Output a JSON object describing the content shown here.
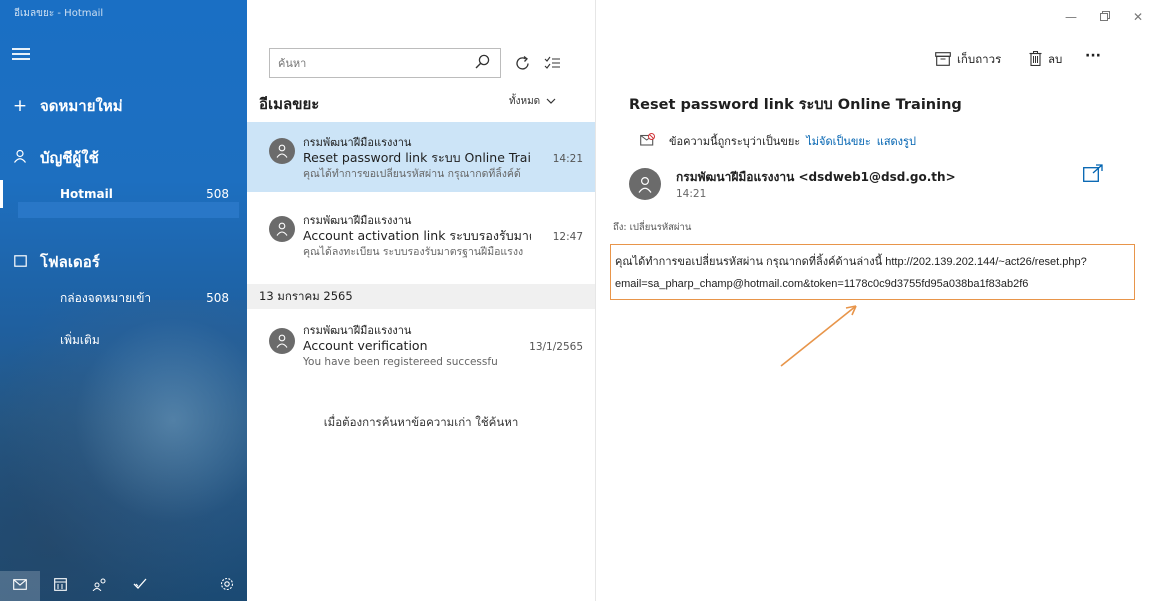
{
  "window": {
    "title": "อีเมลขยะ - Hotmail"
  },
  "nav": {
    "new_mail": "จดหมายใหม่",
    "accounts": "บัญชีผู้ใช้",
    "account_items": [
      {
        "label": "Hotmail",
        "count": "508"
      }
    ],
    "folders": "โฟลเดอร์",
    "folder_items": [
      {
        "label": "กล่องจดหมายเข้า",
        "count": "508"
      },
      {
        "label": "เพิ่มเติม",
        "count": ""
      }
    ]
  },
  "list": {
    "search_placeholder": "ค้นหา",
    "folder_title": "อีเมลขยะ",
    "filter_label": "ทั้งหมด",
    "messages": [
      {
        "sender": "กรมพัฒนาฝีมือแรงงาน",
        "subject": "Reset password link ระบบ Online Training",
        "time": "14:21",
        "preview": "คุณได้ทำการขอเปลี่ยนรหัสผ่าน กรุณากดที่ลิ้งค์ด้"
      },
      {
        "sender": "กรมพัฒนาฝีมือแรงงาน",
        "subject": "Account activation link ระบบรองรับมาตรฐา",
        "time": "12:47",
        "preview": "คุณได้ลงทะเบียน ระบบรองรับมาตรฐานฝีมือแรงง"
      },
      {
        "sender": "กรมพัฒนาฝีมือแรงงาน",
        "subject": "Account verification",
        "time": "13/1/2565",
        "preview": "You have been registereed successfu"
      }
    ],
    "date_group": "13 มกราคม 2565",
    "search_older": "เมื่อต้องการค้นหาข้อความเก่า ใช้ค้นหา"
  },
  "reader": {
    "archive_label": "เก็บถาวร",
    "delete_label": "ลบ",
    "more_label": "···",
    "subject": "Reset password link ระบบ Online Training",
    "junk_notice": "ข้อความนี้ถูกระบุว่าเป็นขยะ",
    "not_junk_link": "ไม่จัดเป็นขยะ",
    "show_images_link": "แสดงรูป",
    "from": "กรมพัฒนาฝีมือแรงงาน <dsdweb1@dsd.go.th>",
    "time": "14:21",
    "to": "ถึง: เปลี่ยนรหัสผ่าน",
    "body_line1": "คุณได้ทำการขอเปลี่ยนรหัสผ่าน กรุณากดที่ลิ้งค์ด้านล่างนี้ http://202.139.202.144/~act26/reset.php?",
    "body_line2": "email=sa_pharp_champ@hotmail.com&token=1178c0c9d3755fd95a038ba1f83ab2f6"
  },
  "colors": {
    "nav_blue": "#1a6fc4",
    "selected_row": "#cce4f7",
    "link": "#0063b1",
    "annotation": "#e8954a"
  },
  "icons": {
    "nav": [
      "hamburger-icon",
      "plus-icon",
      "person-icon",
      "folder-icon"
    ],
    "bottom": [
      "mail-icon",
      "calendar-icon",
      "people-icon",
      "todo-icon",
      "settings-icon"
    ],
    "list_tools": [
      "search-icon",
      "sync-icon",
      "select-mode-icon",
      "chevron-down-icon"
    ],
    "reader": [
      "archive-icon",
      "trash-icon",
      "more-icon",
      "junk-shield-icon",
      "popout-icon",
      "avatar-icon"
    ]
  }
}
